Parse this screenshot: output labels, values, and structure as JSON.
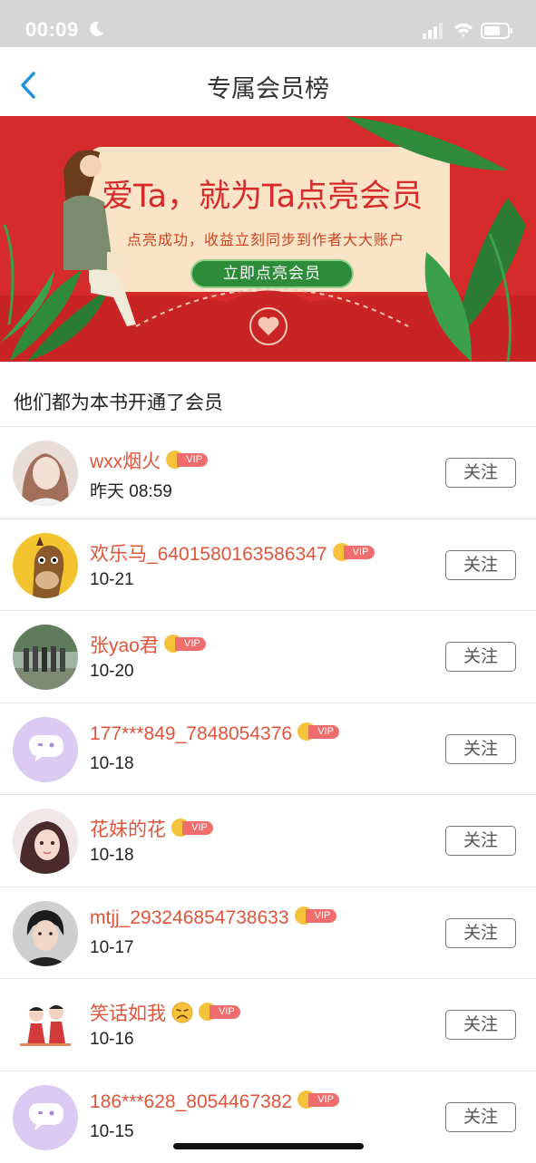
{
  "status_bar": {
    "time": "00:09"
  },
  "header": {
    "title": "专属会员榜"
  },
  "banner": {
    "title": "爱Ta，就为Ta点亮会员",
    "subtitle": "点亮成功，收益立刻同步到作者大大账户",
    "button_label": "立即点亮会员"
  },
  "section": {
    "title": "他们都为本书开通了会员"
  },
  "vip_label": "VIP",
  "follow_label": "关注",
  "members": [
    {
      "name": "wxx烟火",
      "date": "昨天 08:59",
      "avatar": "girl-portrait-avatar"
    },
    {
      "name": "欢乐马_6401580163586347",
      "date": "10-21",
      "avatar": "cartoon-horse-avatar"
    },
    {
      "name": "张yao君",
      "date": "10-20",
      "avatar": "group-photo-avatar"
    },
    {
      "name": "177***849_7848054376",
      "date": "10-18",
      "avatar": "default-chat-avatar"
    },
    {
      "name": "花妹的花",
      "date": "10-18",
      "avatar": "anime-girl-avatar"
    },
    {
      "name": "mtjj_293246854738633",
      "date": "10-17",
      "avatar": "young-man-avatar"
    },
    {
      "name": "笑话如我",
      "date": "10-16",
      "avatar": "cartoon-couple-avatar",
      "emoji": "sad-face"
    },
    {
      "name": "186***628_8054467382",
      "date": "10-15",
      "avatar": "default-chat-avatar"
    }
  ],
  "colors": {
    "accent_red": "#e0553a",
    "banner_red": "#d52c2b",
    "banner_button_green": "#2e8b3a",
    "vip_tag": "#ef6d6d",
    "back_arrow_blue": "#1e90e0"
  }
}
